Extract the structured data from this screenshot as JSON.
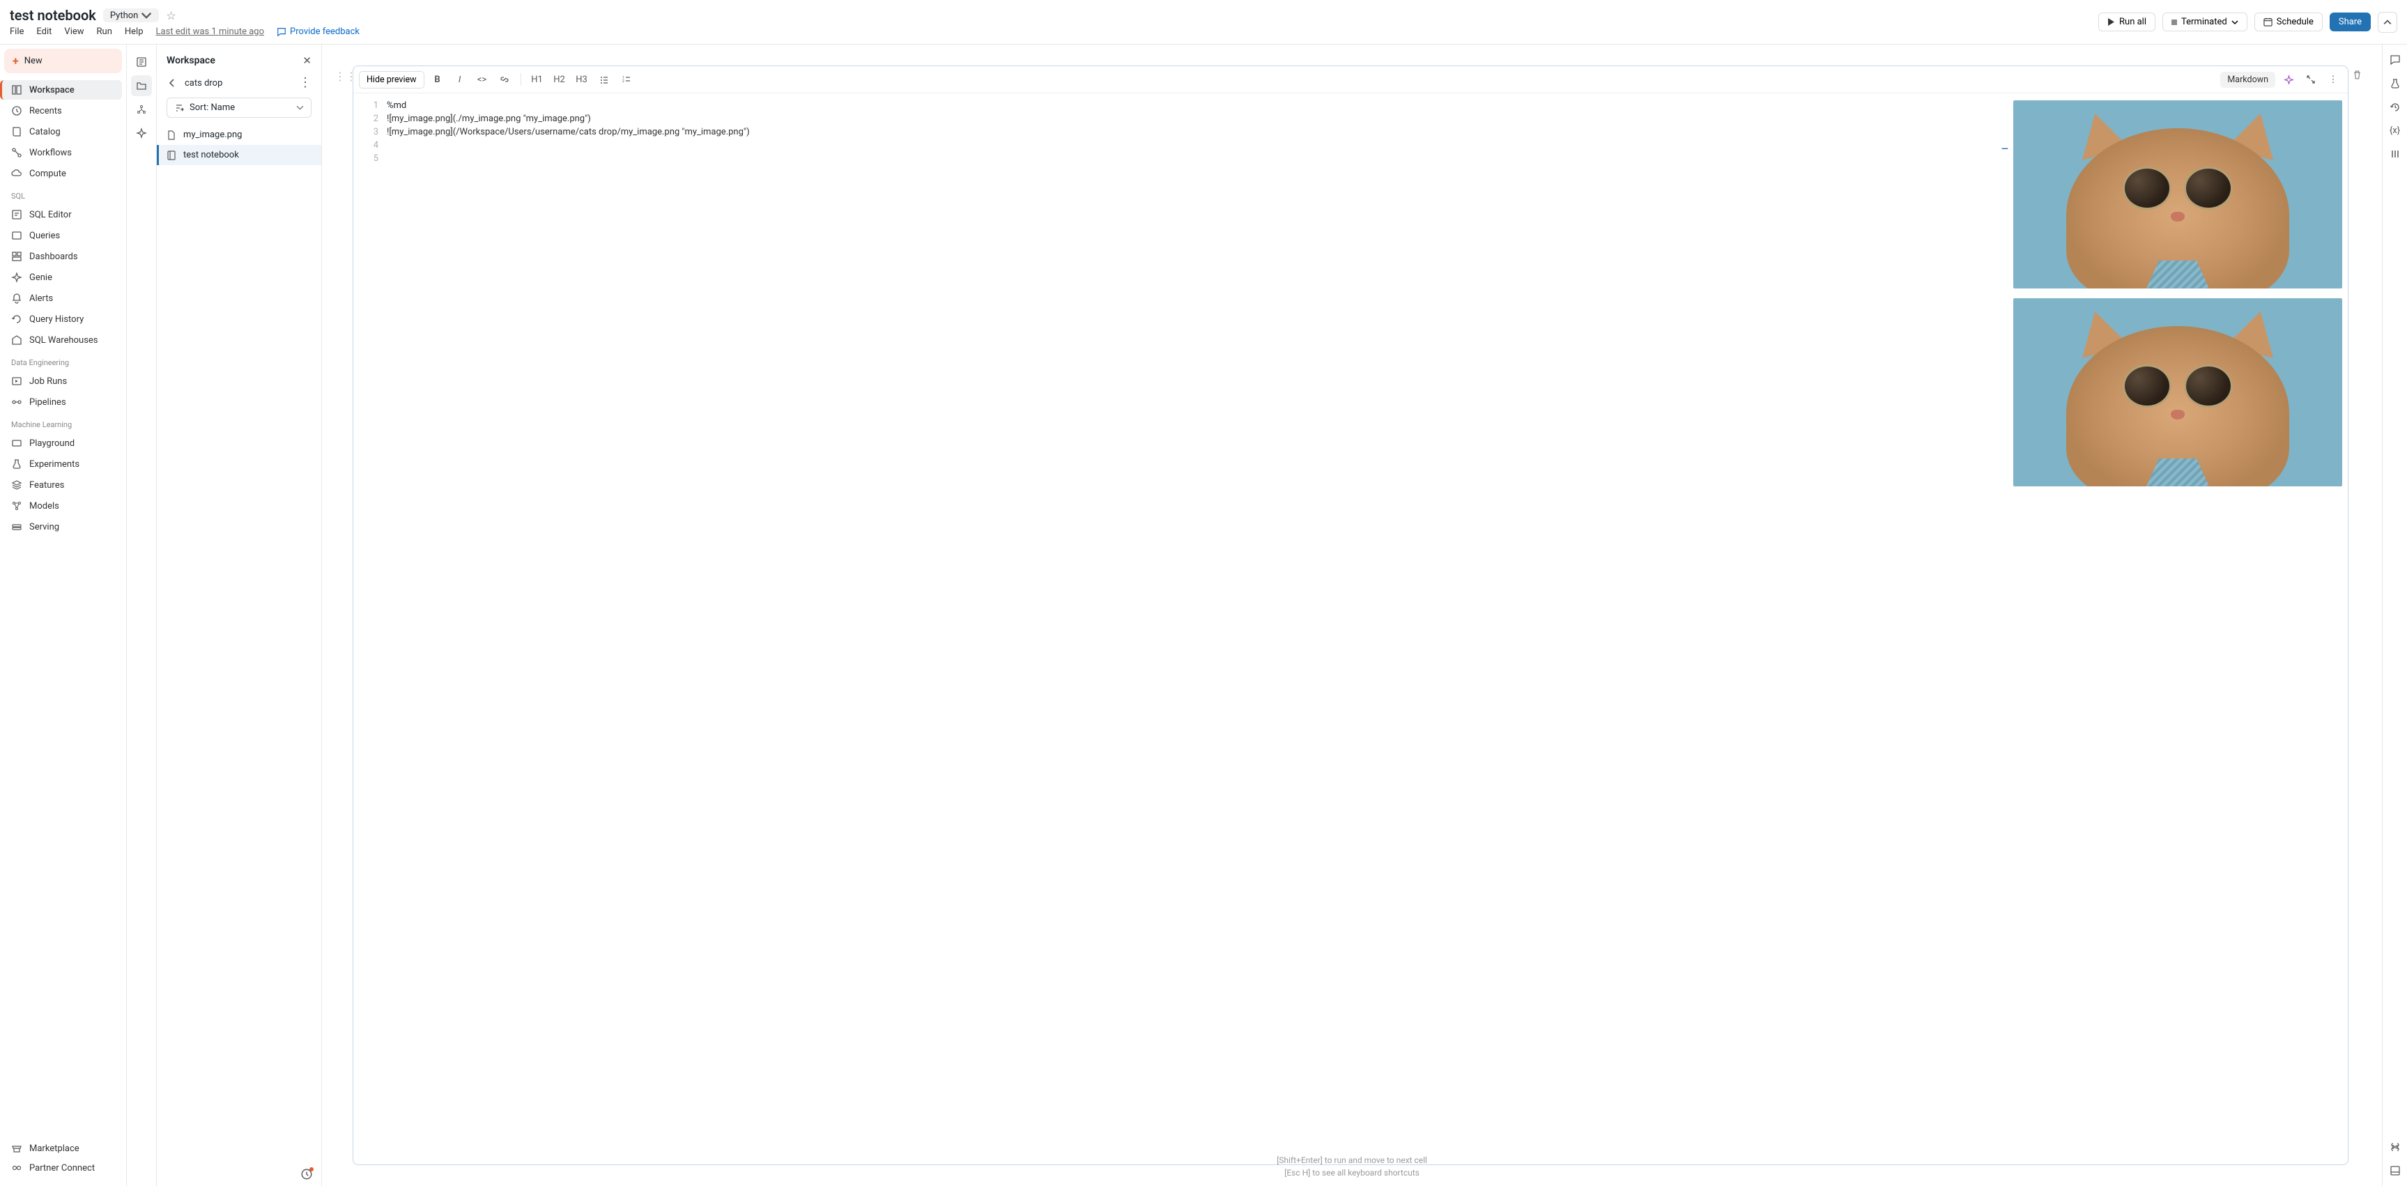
{
  "header": {
    "title": "test notebook",
    "language": "Python",
    "menu": {
      "file": "File",
      "edit": "Edit",
      "view": "View",
      "run": "Run",
      "help": "Help"
    },
    "last_edit": "Last edit was 1 minute ago",
    "feedback": "Provide feedback",
    "run_all": "Run all",
    "status": "Terminated",
    "schedule": "Schedule",
    "share": "Share"
  },
  "sidebar": {
    "new": "New",
    "main": [
      {
        "label": "Workspace",
        "active": true
      },
      {
        "label": "Recents"
      },
      {
        "label": "Catalog"
      },
      {
        "label": "Workflows"
      },
      {
        "label": "Compute"
      }
    ],
    "sql_head": "SQL",
    "sql": [
      {
        "label": "SQL Editor"
      },
      {
        "label": "Queries"
      },
      {
        "label": "Dashboards"
      },
      {
        "label": "Genie"
      },
      {
        "label": "Alerts"
      },
      {
        "label": "Query History"
      },
      {
        "label": "SQL Warehouses"
      }
    ],
    "de_head": "Data Engineering",
    "de": [
      {
        "label": "Job Runs"
      },
      {
        "label": "Pipelines"
      }
    ],
    "ml_head": "Machine Learning",
    "ml": [
      {
        "label": "Playground"
      },
      {
        "label": "Experiments"
      },
      {
        "label": "Features"
      },
      {
        "label": "Models"
      },
      {
        "label": "Serving"
      }
    ],
    "bottom": [
      {
        "label": "Marketplace"
      },
      {
        "label": "Partner Connect"
      }
    ]
  },
  "workspace_panel": {
    "title": "Workspace",
    "path": "cats drop",
    "sort_label": "Sort: Name",
    "files": [
      {
        "name": "my_image.png",
        "type": "file"
      },
      {
        "name": "test notebook",
        "type": "notebook",
        "selected": true
      }
    ]
  },
  "cell": {
    "hide_preview": "Hide preview",
    "headings": {
      "h1": "H1",
      "h2": "H2",
      "h3": "H3"
    },
    "type_label": "Markdown",
    "code": {
      "l1": "%md",
      "l2": "",
      "l3": "![my_image.png](./my_image.png \"my_image.png\")",
      "l4": "",
      "l5": "![my_image.png](/Workspace/Users/username/cats drop/my_image.png \"my_image.png\")"
    },
    "line_numbers": {
      "n1": "1",
      "n2": "2",
      "n3": "3",
      "n4": "4",
      "n5": "5"
    }
  },
  "hints": {
    "l1": "[Shift+Enter] to run and move to next cell",
    "l2": "[Esc H] to see all keyboard shortcuts"
  }
}
